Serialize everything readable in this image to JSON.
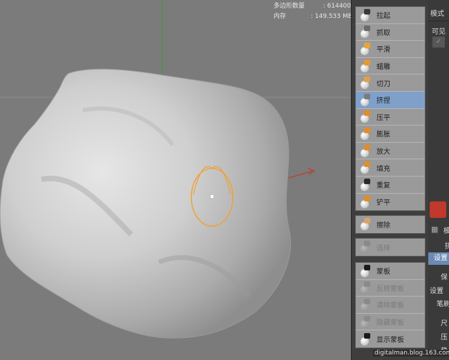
{
  "viewport": {
    "stats": [
      {
        "label": "多边形数量",
        "value": ": 614400"
      },
      {
        "label": "内存",
        "value": ": 149.533 MB"
      }
    ]
  },
  "tool_groups": [
    {
      "tools": [
        {
          "label": "拉起",
          "icon": "pull-brush-icon",
          "mark": "#3a3a3a"
        },
        {
          "label": "抓取",
          "icon": "grab-brush-icon",
          "mark": "#6a6a6a"
        },
        {
          "label": "平滑",
          "icon": "smooth-brush-icon",
          "mark": "#e7a53b"
        },
        {
          "label": "蜡雕",
          "icon": "wax-brush-icon",
          "mark": "#e79a2a"
        },
        {
          "label": "切刀",
          "icon": "knife-brush-icon",
          "mark": "#e0a04a"
        },
        {
          "label": "挤捏",
          "icon": "pinch-brush-icon",
          "mark": "#7c7c7c",
          "active": true
        },
        {
          "label": "压平",
          "icon": "flatten-brush-icon",
          "mark": "#e38c2a"
        },
        {
          "label": "膨胀",
          "icon": "inflate-brush-icon",
          "mark": "#e38c2a"
        },
        {
          "label": "放大",
          "icon": "magnify-brush-icon",
          "mark": "#e38c2a"
        },
        {
          "label": "填充",
          "icon": "fill-brush-icon",
          "mark": "#e38c2a"
        },
        {
          "label": "重复",
          "icon": "repeat-brush-icon",
          "mark": "#2a2a2a"
        },
        {
          "label": "铲平",
          "icon": "scrape-brush-icon",
          "mark": "#e38c2a"
        }
      ]
    },
    {
      "tools": [
        {
          "label": "擦除",
          "icon": "erase-brush-icon",
          "mark": "#d9a36b"
        }
      ]
    },
    {
      "tools": [
        {
          "label": "选择",
          "icon": "select-brush-icon",
          "mark": "#8a8a8a",
          "disabled": true
        }
      ]
    },
    {
      "tools": [
        {
          "label": "蒙板",
          "icon": "mask-brush-icon",
          "mark": "#1a1a1a"
        },
        {
          "label": "反转蒙板",
          "icon": "invert-mask-icon",
          "mark": "#8a8a8a",
          "disabled": true
        },
        {
          "label": "清除蒙板",
          "icon": "clear-mask-icon",
          "mark": "#8a8a8a",
          "disabled": true
        },
        {
          "label": "隐藏蒙板",
          "icon": "hide-mask-icon",
          "mark": "#8a8a8a",
          "disabled": true
        },
        {
          "label": "显示蒙板",
          "icon": "show-mask-icon",
          "mark": "#1a1a1a"
        }
      ]
    }
  ],
  "right_panel": {
    "mode_label": "模式",
    "visible_label": "可见",
    "check_mark": "✓",
    "tab_partial": "模",
    "brush_partial": "挤",
    "settings_tab": "设置",
    "keep_label": "保",
    "settings_header": "设置",
    "stroke_label": "笔刷",
    "size_label": "尺",
    "pressure_label": "压",
    "stamp_label": "稳"
  },
  "watermark": "digitalman.blog.163.com",
  "colors": {
    "active_tool": "#7fa0c9",
    "brush_cursor": "#f0a030",
    "axis_y": "#2fa02f",
    "axis_x": "#c0392b"
  }
}
